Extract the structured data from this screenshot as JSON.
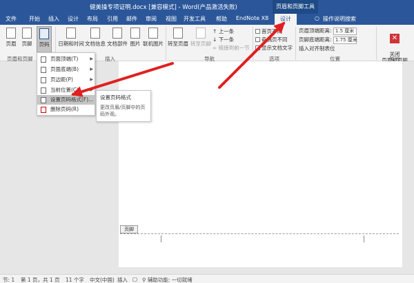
{
  "window": {
    "title": "健美操专项证明.docx [兼容模式] - Word(产品激活失败)",
    "context_tools_label": "页眉和页脚工具"
  },
  "tabs": [
    "文件",
    "开始",
    "插入",
    "设计",
    "布局",
    "引用",
    "邮件",
    "审阅",
    "视图",
    "开发工具",
    "帮助",
    "EndNote X8",
    "设计",
    "操作说明搜索"
  ],
  "ribbon": {
    "header": "页眉",
    "footer": "页脚",
    "page_number": "页码",
    "group_header_footer": "页眉和页脚",
    "date_time": "日期和时间",
    "doc_info": "文档信息",
    "doc_parts": "文档部件",
    "picture": "图片",
    "online_picture": "联机图片",
    "group_insert": "插入",
    "goto_header": "转至页眉",
    "goto_footer": "转至页脚",
    "prev": "上一条",
    "next": "下一条",
    "link_prev": "链接到前一节",
    "group_nav": "导航",
    "first_page_diff": "首页不同",
    "odd_even_diff": "奇偶页不同",
    "show_doc_text": "显示文档文字",
    "group_options": "选项",
    "header_top_label": "页眉顶端距离:",
    "header_top_value": "1.5 厘米",
    "footer_bottom_label": "页脚底端距离:",
    "footer_bottom_value": "1.75 厘米",
    "insert_align_tab": "插入对齐制表位",
    "group_position": "位置",
    "close_label": "关闭\n页眉和页脚",
    "group_close": "关闭"
  },
  "menu": {
    "items": [
      "页面顶端(T)",
      "页面底端(B)",
      "页边距(P)",
      "当前位置(C)",
      "设置页码格式(F)...",
      "删除页码(R)"
    ],
    "tooltip_title": "设置页码格式",
    "tooltip_desc": "更改页眉/页脚中的页码外观。"
  },
  "document": {
    "footer_tag": "页脚"
  },
  "status": {
    "section": "节: 1",
    "page": "第 1 页，共 1 页",
    "words": "11 个字",
    "language": "中文(中国)",
    "insert_mode": "插入",
    "accessibility": "辅助功能: 一切就绪"
  },
  "colors": {
    "brand": "#2b579a",
    "arrow": "#e02020"
  }
}
